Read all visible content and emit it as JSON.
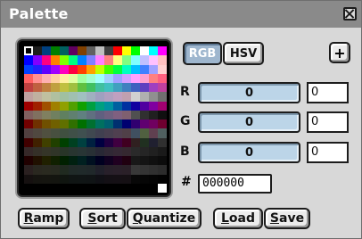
{
  "window": {
    "title": "Palette"
  },
  "palette": {
    "colors": [
      "#000000",
      "#1e1e1e",
      "#004080",
      "#008000",
      "#006060",
      "#600060",
      "#804000",
      "#606060",
      "#c0c0c0",
      "#404040",
      "#ff0000",
      "#ffff00",
      "#00ff00",
      "#ffffff",
      "#00ffff",
      "#ff00ff",
      "#0000ff",
      "#8000ff",
      "#ff0080",
      "#ff8000",
      "#80ff00",
      "#00ff80",
      "#0080ff",
      "#8080ff",
      "#ff80ff",
      "#ff8080",
      "#ffff80",
      "#80ff80",
      "#80ffff",
      "#c0c0ff",
      "#ffc0ff",
      "#ffc0c0",
      "#0040ff",
      "#2020ff",
      "#6000ff",
      "#a000ff",
      "#ff00c0",
      "#ff0040",
      "#ff4000",
      "#ffa000",
      "#c0ff00",
      "#40ff00",
      "#00ff40",
      "#00ffc0",
      "#00c0ff",
      "#4080ff",
      "#a0a0ff",
      "#ffd0d0",
      "#ff6060",
      "#ff9090",
      "#ffb0b0",
      "#ffd0a0",
      "#fff0a0",
      "#e0ffa0",
      "#a0ffa0",
      "#a0ffd0",
      "#a0ffff",
      "#a0d0ff",
      "#a0a0ff",
      "#d0a0ff",
      "#ffa0ff",
      "#ffa0d0",
      "#ff8080",
      "#ff6080",
      "#c04040",
      "#c06040",
      "#c08040",
      "#c0a040",
      "#c0c040",
      "#a0c040",
      "#60c040",
      "#40c060",
      "#40c0a0",
      "#40c0c0",
      "#40a0c0",
      "#4080c0",
      "#4060c0",
      "#6040c0",
      "#a040c0",
      "#c040a0",
      "#c0a0a0",
      "#c0b0a0",
      "#c0c0a0",
      "#b0c0a0",
      "#a0c0a0",
      "#a0c0b0",
      "#a0c0c0",
      "#a0b0c0",
      "#a0a0c0",
      "#b0a0c0",
      "#c0a0c0",
      "#c0a0b0",
      "#d0d0d0",
      "#b0b0b0",
      "#909090",
      "#707070",
      "#a00000",
      "#a02000",
      "#a05000",
      "#a08000",
      "#90a000",
      "#50a000",
      "#10a000",
      "#00a040",
      "#00a080",
      "#0090a0",
      "#0060a0",
      "#0030a0",
      "#1000a0",
      "#5000a0",
      "#8000a0",
      "#a00070",
      "#806060",
      "#807060",
      "#808060",
      "#708060",
      "#608060",
      "#608070",
      "#608080",
      "#607080",
      "#606080",
      "#706080",
      "#806080",
      "#806070",
      "#505050",
      "#303030",
      "#202020",
      "#101010",
      "#700000",
      "#703000",
      "#705000",
      "#706000",
      "#607000",
      "#307000",
      "#007000",
      "#007030",
      "#007060",
      "#006070",
      "#003070",
      "#000070",
      "#300070",
      "#600070",
      "#700060",
      "#700030",
      "#504040",
      "#504840",
      "#505040",
      "#485040",
      "#405040",
      "#405048",
      "#405050",
      "#404850",
      "#404050",
      "#484050",
      "#504050",
      "#504048",
      "#405060",
      "#506040",
      "#604050",
      "#506060",
      "#400000",
      "#402000",
      "#404000",
      "#204000",
      "#004000",
      "#004020",
      "#004040",
      "#002040",
      "#000040",
      "#200040",
      "#400040",
      "#400020",
      "#302020",
      "#203020",
      "#202030",
      "#303030",
      "#352828",
      "#353028",
      "#353528",
      "#303528",
      "#283528",
      "#283530",
      "#283535",
      "#283035",
      "#282835",
      "#302835",
      "#352835",
      "#352830",
      "#2a2a2a",
      "#252525",
      "#202020",
      "#1a1a1a",
      "#200000",
      "#201000",
      "#202000",
      "#102000",
      "#002000",
      "#002010",
      "#002020",
      "#001020",
      "#000020",
      "#100020",
      "#200020",
      "#200010",
      "#181818",
      "#141414",
      "#101010",
      "#0c0c0c",
      "#2a2020",
      "#2a2820",
      "#2a2a20",
      "#282a20",
      "#202a20",
      "#202a28",
      "#202a2a",
      "#20282a",
      "#20202a",
      "#28202a",
      "#2a202a",
      "#2a2028",
      "#383838",
      "#343434",
      "#303030",
      "#2c2c2c",
      "#151010",
      "#151410",
      "#151510",
      "#141510",
      "#101510",
      "#101514",
      "#101515",
      "#101415",
      "#101015",
      "#141015",
      "#151015",
      "#151014",
      "#080808",
      "#060606",
      "#040404",
      "#020202",
      "#000000",
      "#000000",
      "#000000",
      "#000000",
      "#000000",
      "#000000",
      "#000000",
      "#000000",
      "#000000",
      "#000000",
      "#000000",
      "#000000",
      "#000000",
      "#000000",
      "#000000",
      "#ffffff"
    ]
  },
  "mode": {
    "rgb_label": "RGB",
    "hsv_label": "HSV",
    "active": "RGB"
  },
  "add_label": "+",
  "channels": {
    "r": {
      "label": "R",
      "slider_value": "0",
      "field_value": "0"
    },
    "g": {
      "label": "G",
      "slider_value": "0",
      "field_value": "0"
    },
    "b": {
      "label": "B",
      "slider_value": "0",
      "field_value": "0"
    }
  },
  "hex": {
    "label": "#",
    "value": "000000"
  },
  "buttons": {
    "ramp": {
      "mnemonic": "R",
      "rest": "amp"
    },
    "sort": {
      "mnemonic": "S",
      "rest": "ort"
    },
    "quantize": {
      "mnemonic": "Q",
      "rest": "uantize"
    },
    "load": {
      "mnemonic": "L",
      "rest": "oad"
    },
    "save": {
      "mnemonic": "S",
      "rest": "ave"
    }
  },
  "colors": {
    "titlebar": "#8a8a8a",
    "window_bg": "#d8d8d8",
    "active_mode": "#9eb6ce",
    "slider_fill": "#bcd5e8"
  }
}
